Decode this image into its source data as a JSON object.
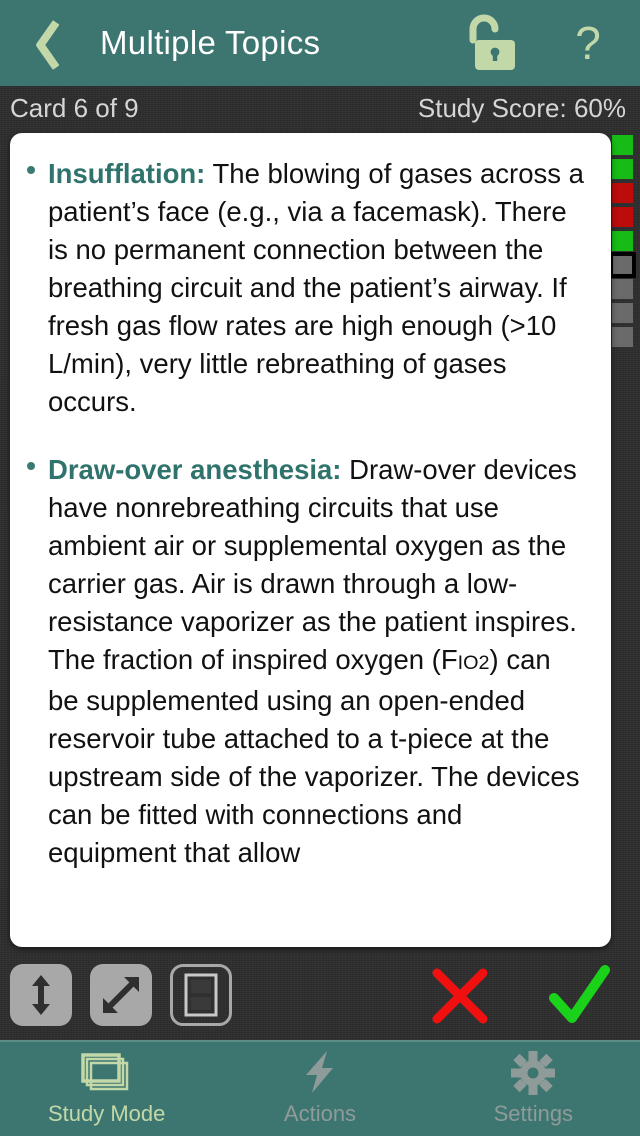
{
  "header": {
    "title": "Multiple Topics",
    "back_icon": "chevron-left-icon",
    "lock_icon": "unlocked-padlock-icon",
    "help_label": "?",
    "bg_color": "#3d7670",
    "accent_color": "#c3d8a8"
  },
  "status": {
    "card_counter": "Card 6 of 9",
    "study_score": "Study Score: 60%"
  },
  "card": {
    "paragraphs": [
      {
        "lead": "Insufflation:",
        "body": " The blowing of gases across a patient’s face (e.g., via a facemask). There is no permanent connection between the breathing circuit and the patient’s airway. If fresh gas flow rates are high enough (>10 L/min), very little rebreathing of gases occurs."
      },
      {
        "lead": "Draw-over anesthesia:",
        "body_1": " Draw-over devices have nonrebreathing circuits that use ambient air or supplemental oxygen as the carrier gas. Air is drawn through a low-resistance vaporizer as the patient inspires. The fraction of inspired oxygen (F",
        "sub": "IO2",
        "body_2": ") can be supplemented using an open-ended reservoir tube attached to a t-piece at the upstream side of the vaporizer. The devices can be fitted with connections and equipment that allow"
      }
    ],
    "lead_color": "#2f736c",
    "background": "#ffffff"
  },
  "progress_markers": {
    "items": [
      {
        "state": "correct",
        "color": "#16bb16"
      },
      {
        "state": "correct",
        "color": "#16bb16"
      },
      {
        "state": "wrong",
        "color": "#bb0b0b"
      },
      {
        "state": "wrong",
        "color": "#bb0b0b"
      },
      {
        "state": "correct",
        "color": "#16bb16"
      },
      {
        "state": "current",
        "color": "#6a6a6a"
      },
      {
        "state": "unanswered",
        "color": "#6a6a6a"
      },
      {
        "state": "unanswered",
        "color": "#6a6a6a"
      },
      {
        "state": "unanswered",
        "color": "#6a6a6a"
      }
    ]
  },
  "toolbar": {
    "resize_icon": "vertical-resize-arrows-icon",
    "expand_icon": "diagonal-expand-arrows-icon",
    "split_icon": "split-card-view-icon",
    "wrong_icon": "red-x-icon",
    "right_icon": "green-check-icon",
    "wrong_color": "#f01010",
    "right_color": "#19d219"
  },
  "tabbar": {
    "tabs": [
      {
        "label": "Study Mode",
        "icon": "card-stack-icon",
        "active": true
      },
      {
        "label": "Actions",
        "icon": "lightning-bolt-icon",
        "active": false
      },
      {
        "label": "Settings",
        "icon": "gear-icon",
        "active": false
      }
    ]
  }
}
